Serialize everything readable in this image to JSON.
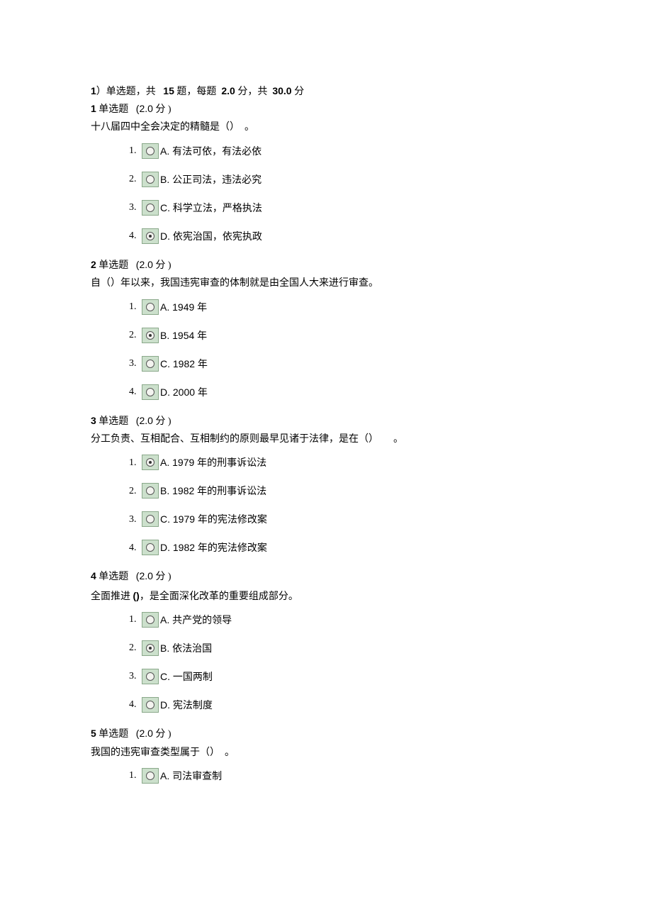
{
  "section_header_prefix": "1",
  "section_header_a": "）单选题，共",
  "section_header_count": "15",
  "section_header_b": "题，每题",
  "section_header_pts": "2.0",
  "section_header_c": "分，共",
  "section_header_total": "30.0",
  "section_header_d": "分",
  "qtype_label": "单选题",
  "pts_open": "(2.0",
  "pts_close": "分 )",
  "questions": [
    {
      "num": "1",
      "stem": "十八届四中全会决定的精髓是（）　。",
      "options": [
        {
          "letter": "A.",
          "text": " 有法可依，有法必依",
          "selected": false
        },
        {
          "letter": "B.",
          "text": " 公正司法，违法必究",
          "selected": false
        },
        {
          "letter": "C.",
          "text": " 科学立法，严格执法",
          "selected": false
        },
        {
          "letter": "D.",
          "text": " 依宪治国，依宪执政",
          "selected": true
        }
      ]
    },
    {
      "num": "2",
      "stem": "自（）年以来，我国违宪审查的体制就是由全国人大来进行审查。",
      "options": [
        {
          "letter": "A.",
          "text": " 1949 年",
          "selected": false
        },
        {
          "letter": "B.",
          "text": " 1954 年",
          "selected": true
        },
        {
          "letter": "C.",
          "text": " 1982 年",
          "selected": false
        },
        {
          "letter": "D.",
          "text": " 2000 年",
          "selected": false
        }
      ]
    },
    {
      "num": "3",
      "stem": "分工负责、互相配合、互相制约的原则最早见诸于法律，是在（）　　。",
      "options": [
        {
          "letter": "A.",
          "text": " 1979 年的刑事诉讼法",
          "selected": true
        },
        {
          "letter": "B.",
          "text": " 1982 年的刑事诉讼法",
          "selected": false
        },
        {
          "letter": "C.",
          "text": " 1979 年的宪法修改案",
          "selected": false
        },
        {
          "letter": "D.",
          "text": " 1982 年的宪法修改案",
          "selected": false
        }
      ]
    },
    {
      "num": "4",
      "stem_pre": "全面推进 ",
      "stem_bold": "()",
      "stem_post": "，是全面深化改革的重要组成部分。",
      "options": [
        {
          "letter": "A.",
          "text": " 共产党的领导",
          "selected": false
        },
        {
          "letter": "B.",
          "text": " 依法治国",
          "selected": true
        },
        {
          "letter": "C.",
          "text": " 一国两制",
          "selected": false
        },
        {
          "letter": "D.",
          "text": " 宪法制度",
          "selected": false
        }
      ]
    },
    {
      "num": "5",
      "stem": "我国的违宪审查类型属于（）　。",
      "options": [
        {
          "letter": "A.",
          "text": " 司法审查制",
          "selected": false
        }
      ]
    }
  ]
}
